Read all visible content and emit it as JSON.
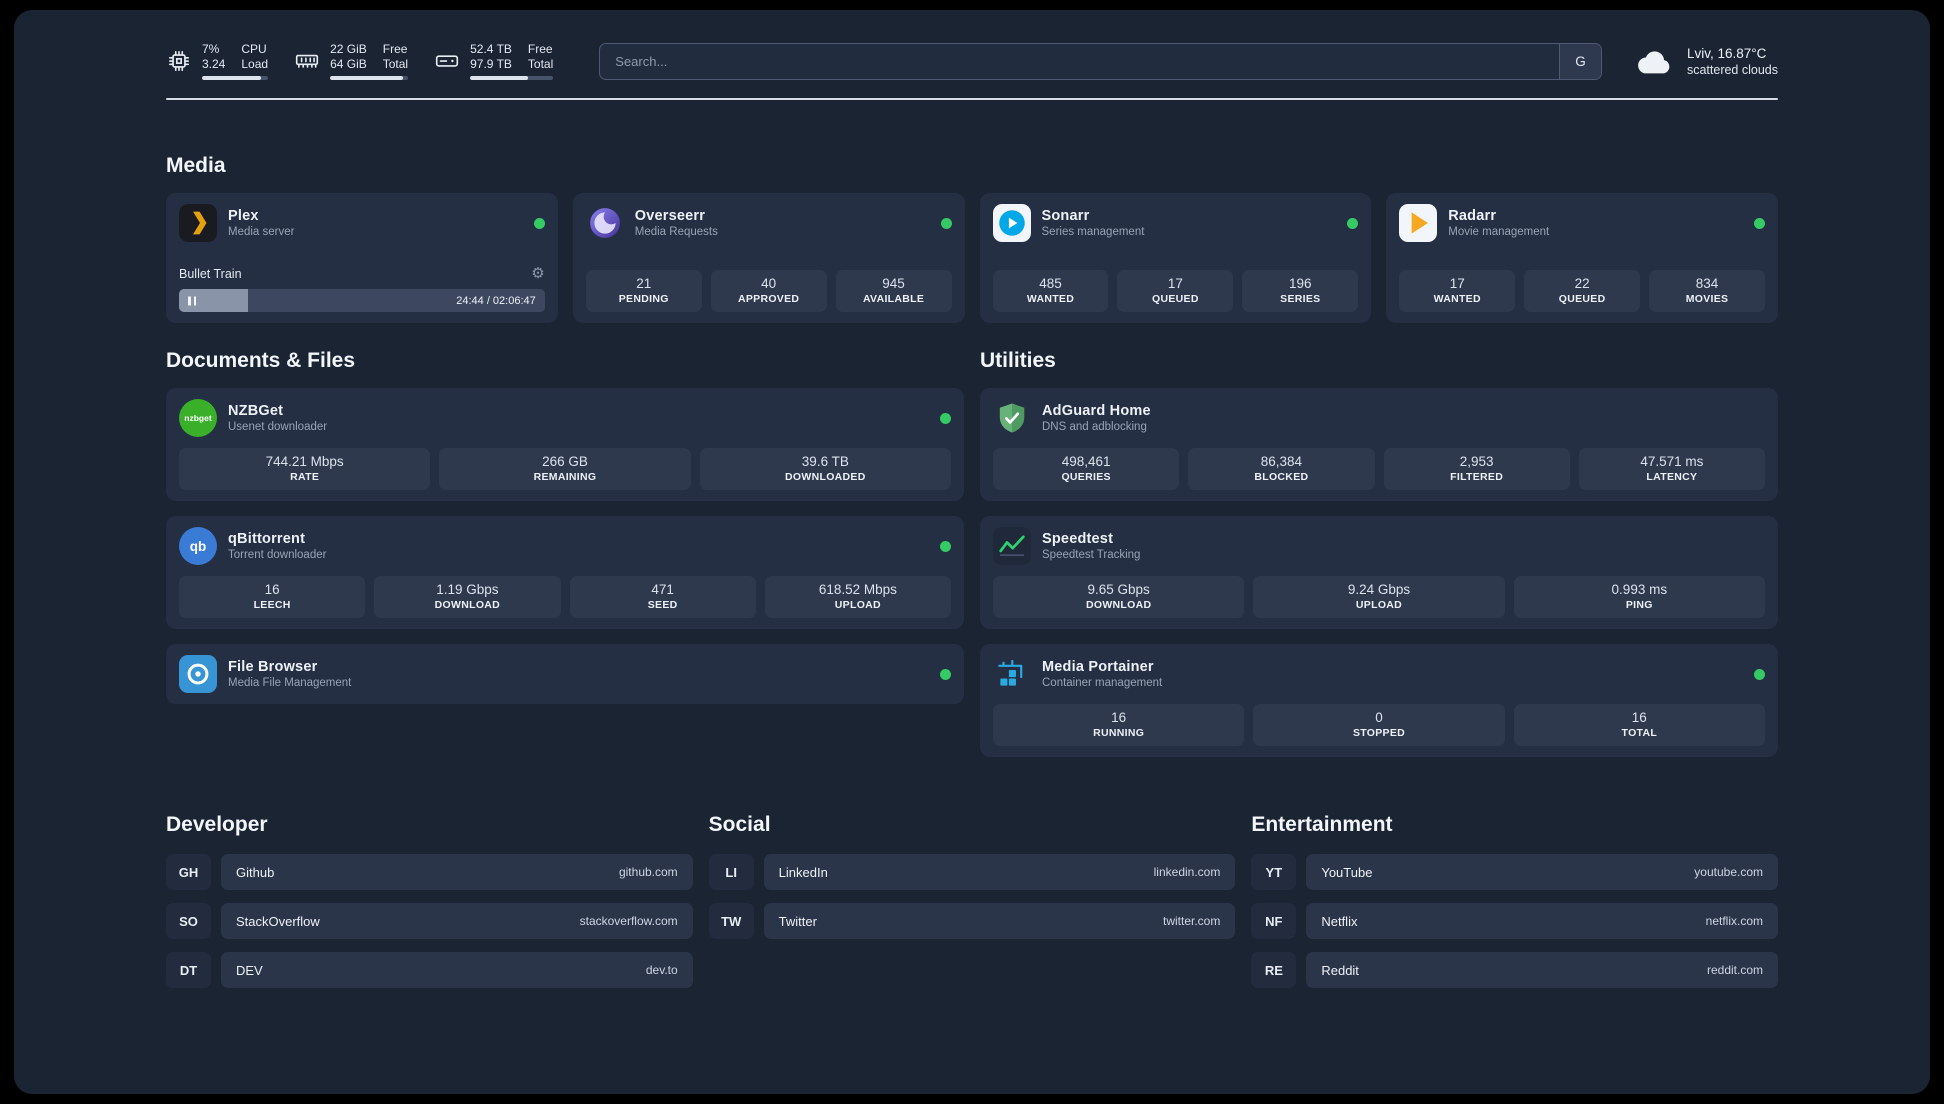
{
  "theme": {
    "background": "#1b2433",
    "card": "#252f43",
    "tile": "#2e394e",
    "status_green": "#35ca63",
    "plex_amber": "#e5a00d"
  },
  "header": {
    "cpu": {
      "value_top": "7%",
      "value_bottom": "3.24",
      "label_top": "CPU",
      "label_bottom": "Load",
      "progress_percent": 90
    },
    "memory": {
      "value_top": "22 GiB",
      "value_bottom": "64 GiB",
      "label_top": "Free",
      "label_bottom": "Total",
      "progress_percent": 93
    },
    "storage": {
      "value_top": "52.4 TB",
      "value_bottom": "97.9 TB",
      "label_top": "Free",
      "label_bottom": "Total",
      "progress_percent": 70
    },
    "search": {
      "placeholder": "Search...",
      "engine_label": "G"
    },
    "weather": {
      "location": "Lviv, 16.87°C",
      "condition": "scattered clouds"
    }
  },
  "media": {
    "title": "Media",
    "plex": {
      "name": "Plex",
      "subtitle": "Media server",
      "now_playing": "Bullet Train",
      "time": "24:44 / 02:06:47",
      "progress_percent": 19
    },
    "overseerr": {
      "name": "Overseerr",
      "subtitle": "Media Requests",
      "stats": [
        {
          "value": "21",
          "label": "PENDING"
        },
        {
          "value": "40",
          "label": "APPROVED"
        },
        {
          "value": "945",
          "label": "AVAILABLE"
        }
      ]
    },
    "sonarr": {
      "name": "Sonarr",
      "subtitle": "Series management",
      "stats": [
        {
          "value": "485",
          "label": "WANTED"
        },
        {
          "value": "17",
          "label": "QUEUED"
        },
        {
          "value": "196",
          "label": "SERIES"
        }
      ]
    },
    "radarr": {
      "name": "Radarr",
      "subtitle": "Movie management",
      "stats": [
        {
          "value": "17",
          "label": "WANTED"
        },
        {
          "value": "22",
          "label": "QUEUED"
        },
        {
          "value": "834",
          "label": "MOVIES"
        }
      ]
    }
  },
  "documents": {
    "title": "Documents & Files",
    "nzbget": {
      "name": "NZBGet",
      "subtitle": "Usenet downloader",
      "icon_text": "nzbget",
      "stats": [
        {
          "value": "744.21 Mbps",
          "label": "RATE"
        },
        {
          "value": "266 GB",
          "label": "REMAINING"
        },
        {
          "value": "39.6 TB",
          "label": "DOWNLOADED"
        }
      ]
    },
    "qbittorrent": {
      "name": "qBittorrent",
      "subtitle": "Torrent downloader",
      "icon_text": "qb",
      "stats": [
        {
          "value": "16",
          "label": "LEECH"
        },
        {
          "value": "1.19 Gbps",
          "label": "DOWNLOAD"
        },
        {
          "value": "471",
          "label": "SEED"
        },
        {
          "value": "618.52 Mbps",
          "label": "UPLOAD"
        }
      ]
    },
    "filebrowser": {
      "name": "File Browser",
      "subtitle": "Media File Management"
    }
  },
  "utilities": {
    "title": "Utilities",
    "adguard": {
      "name": "AdGuard Home",
      "subtitle": "DNS and adblocking",
      "stats": [
        {
          "value": "498,461",
          "label": "QUERIES"
        },
        {
          "value": "86,384",
          "label": "BLOCKED"
        },
        {
          "value": "2,953",
          "label": "FILTERED"
        },
        {
          "value": "47.571 ms",
          "label": "LATENCY"
        }
      ]
    },
    "speedtest": {
      "name": "Speedtest",
      "subtitle": "Speedtest Tracking",
      "stats": [
        {
          "value": "9.65 Gbps",
          "label": "DOWNLOAD"
        },
        {
          "value": "9.24 Gbps",
          "label": "UPLOAD"
        },
        {
          "value": "0.993 ms",
          "label": "PING"
        }
      ]
    },
    "portainer": {
      "name": "Media Portainer",
      "subtitle": "Container management",
      "stats": [
        {
          "value": "16",
          "label": "RUNNING"
        },
        {
          "value": "0",
          "label": "STOPPED"
        },
        {
          "value": "16",
          "label": "TOTAL"
        }
      ]
    }
  },
  "links": {
    "developer": {
      "title": "Developer",
      "items": [
        {
          "abbr": "GH",
          "name": "Github",
          "url": "github.com"
        },
        {
          "abbr": "SO",
          "name": "StackOverflow",
          "url": "stackoverflow.com"
        },
        {
          "abbr": "DT",
          "name": "DEV",
          "url": "dev.to"
        }
      ]
    },
    "social": {
      "title": "Social",
      "items": [
        {
          "abbr": "LI",
          "name": "LinkedIn",
          "url": "linkedin.com"
        },
        {
          "abbr": "TW",
          "name": "Twitter",
          "url": "twitter.com"
        }
      ]
    },
    "entertainment": {
      "title": "Entertainment",
      "items": [
        {
          "abbr": "YT",
          "name": "YouTube",
          "url": "youtube.com"
        },
        {
          "abbr": "NF",
          "name": "Netflix",
          "url": "netflix.com"
        },
        {
          "abbr": "RE",
          "name": "Reddit",
          "url": "reddit.com"
        }
      ]
    }
  }
}
